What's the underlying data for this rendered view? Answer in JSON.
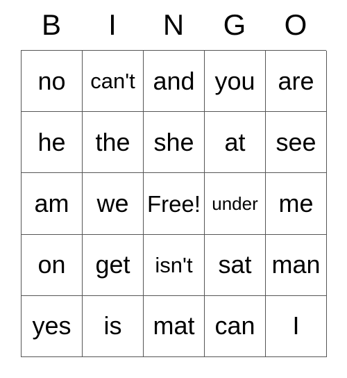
{
  "card": {
    "headers": [
      "B",
      "I",
      "N",
      "G",
      "O"
    ],
    "rows": [
      [
        {
          "text": "no",
          "fit": "normal"
        },
        {
          "text": "can't",
          "fit": "tighter"
        },
        {
          "text": "and",
          "fit": "normal"
        },
        {
          "text": "you",
          "fit": "normal"
        },
        {
          "text": "are",
          "fit": "normal"
        }
      ],
      [
        {
          "text": "he",
          "fit": "normal"
        },
        {
          "text": "the",
          "fit": "normal"
        },
        {
          "text": "she",
          "fit": "normal"
        },
        {
          "text": "at",
          "fit": "normal"
        },
        {
          "text": "see",
          "fit": "normal"
        }
      ],
      [
        {
          "text": "am",
          "fit": "normal"
        },
        {
          "text": "we",
          "fit": "normal"
        },
        {
          "text": "Free!",
          "fit": "tight"
        },
        {
          "text": "under",
          "fit": "small"
        },
        {
          "text": "me",
          "fit": "normal"
        }
      ],
      [
        {
          "text": "on",
          "fit": "normal"
        },
        {
          "text": "get",
          "fit": "normal"
        },
        {
          "text": "isn't",
          "fit": "tighter"
        },
        {
          "text": "sat",
          "fit": "normal"
        },
        {
          "text": "man",
          "fit": "normal"
        }
      ],
      [
        {
          "text": "yes",
          "fit": "normal"
        },
        {
          "text": "is",
          "fit": "normal"
        },
        {
          "text": "mat",
          "fit": "normal"
        },
        {
          "text": "can",
          "fit": "normal"
        },
        {
          "text": "I",
          "fit": "normal"
        }
      ]
    ],
    "free_space": {
      "row": 2,
      "col": 2,
      "label": "Free!"
    },
    "colors": {
      "background": "#ffffff",
      "text": "#000000",
      "grid_line": "#555555"
    }
  }
}
